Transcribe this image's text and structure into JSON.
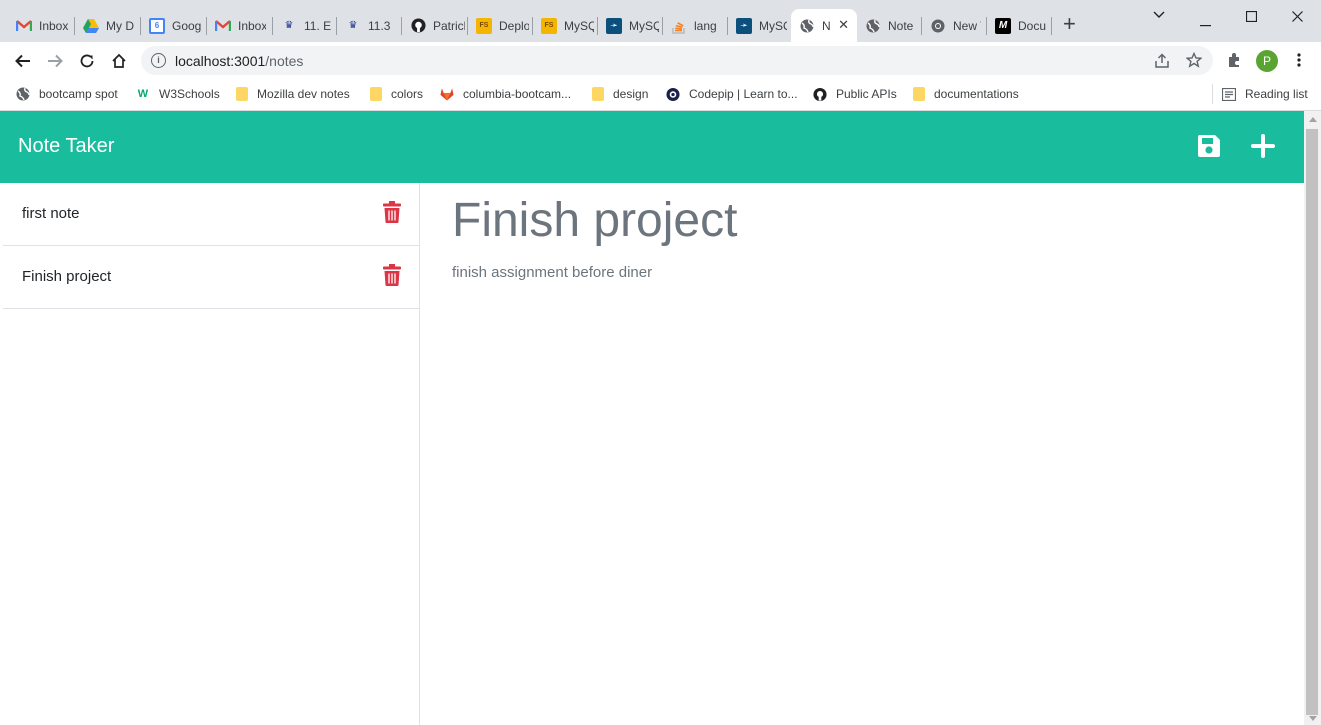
{
  "browser": {
    "tabs": [
      {
        "title": "Inbox",
        "icon": "gmail-icon",
        "color": "#ea4335"
      },
      {
        "title": "My Drive",
        "icon": "drive-icon",
        "color": "#1fa463"
      },
      {
        "title": "Google Calendar",
        "icon": "calendar-icon",
        "color": "#4285f4"
      },
      {
        "title": "Inbox",
        "icon": "gmail-icon",
        "color": "#ea4335"
      },
      {
        "title": "11. E",
        "icon": "bootcamp-icon",
        "color": "#1f3a93"
      },
      {
        "title": "11.3",
        "icon": "bootcamp-icon",
        "color": "#1f3a93"
      },
      {
        "title": "Patrick",
        "icon": "github-icon",
        "color": "#202124"
      },
      {
        "title": "Deploy",
        "icon": "fs-icon",
        "color": "#f4b400"
      },
      {
        "title": "MySQL",
        "icon": "fs-icon",
        "color": "#f4b400"
      },
      {
        "title": "MySQL",
        "icon": "mysql-icon",
        "color": "#0b4f7c"
      },
      {
        "title": "lang",
        "icon": "stackoverflow-icon",
        "color": "#f48024"
      },
      {
        "title": "MySQL",
        "icon": "mysql-icon",
        "color": "#0b4f7c"
      },
      {
        "title": "Note Taker",
        "icon": "globe-icon",
        "color": "#5f6368"
      },
      {
        "title": "Note",
        "icon": "globe-icon",
        "color": "#5f6368"
      },
      {
        "title": "New Tab",
        "icon": "chrome-icon",
        "color": "#5f6368"
      },
      {
        "title": "Docu",
        "icon": "m-icon",
        "color": "#000000"
      }
    ],
    "url_host": "localhost:3001",
    "url_path": "/notes",
    "profile_initial": "P",
    "bookmarks": [
      {
        "label": "bootcamp spot",
        "icon": "globe-icon"
      },
      {
        "label": "W3Schools",
        "icon": "w3schools-icon"
      },
      {
        "label": "Mozilla dev notes",
        "icon": "folder-icon"
      },
      {
        "label": "colors",
        "icon": "folder-icon"
      },
      {
        "label": "columbia-bootcam...",
        "icon": "gitlab-icon"
      },
      {
        "label": "design",
        "icon": "folder-icon"
      },
      {
        "label": "Codepip | Learn to...",
        "icon": "codepip-icon"
      },
      {
        "label": "Public APIs",
        "icon": "github-icon"
      },
      {
        "label": "documentations",
        "icon": "folder-icon"
      }
    ],
    "reading_list": "Reading list"
  },
  "app": {
    "title": "Note Taker",
    "accent": "#19bc9c",
    "delete_color": "#dc3545",
    "notes": [
      {
        "title": "first note"
      },
      {
        "title": "Finish project"
      }
    ],
    "active_note": {
      "title": "Finish project",
      "text": "finish assignment before diner"
    }
  }
}
